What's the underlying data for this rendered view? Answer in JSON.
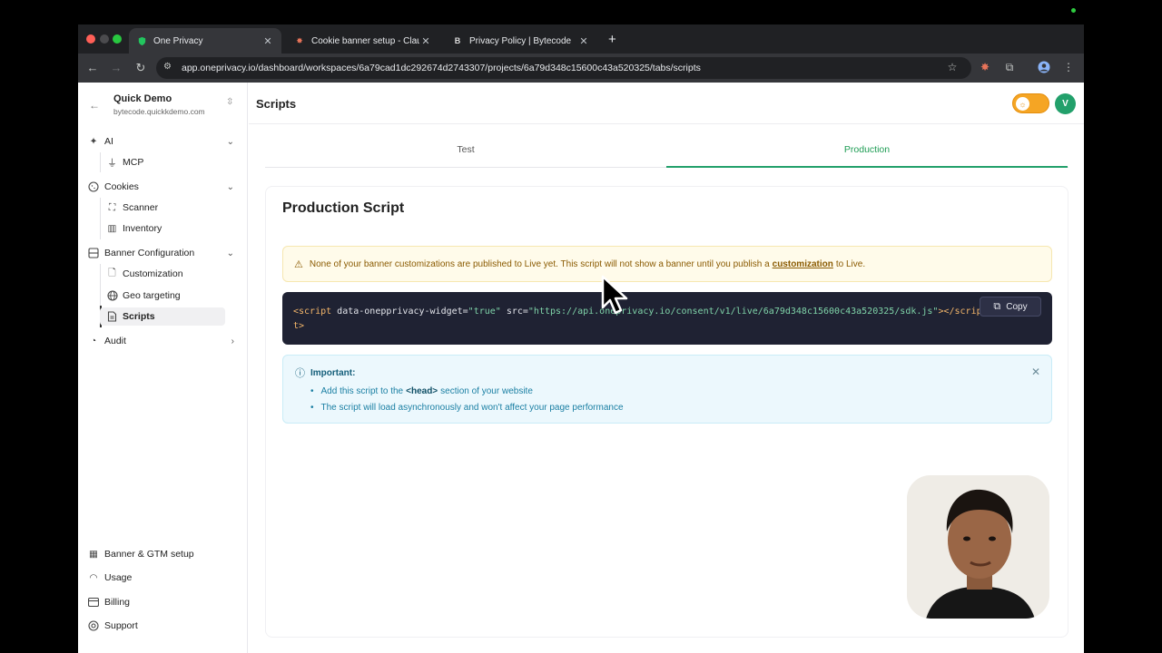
{
  "browser": {
    "tabs": [
      {
        "title": "One Privacy",
        "active": true
      },
      {
        "title": "Cookie banner setup - Claude",
        "active": false
      },
      {
        "title": "Privacy Policy | Bytecode",
        "active": false
      }
    ],
    "url": "app.oneprivacy.io/dashboard/workspaces/6a79cad1dc292674d2743307/projects/6a79d348c15600c43a520325/tabs/scripts"
  },
  "workspace": {
    "name": "Quick Demo",
    "domain": "bytecode.quickkdemo.com"
  },
  "sidebar": {
    "sections": [
      {
        "label": "AI",
        "icon": "sparkles-icon",
        "items": [
          {
            "label": "MCP",
            "icon": "plug-icon"
          }
        ]
      },
      {
        "label": "Cookies",
        "icon": "cookie-icon",
        "items": [
          {
            "label": "Scanner",
            "icon": "scan-icon"
          },
          {
            "label": "Inventory",
            "icon": "library-icon"
          }
        ]
      },
      {
        "label": "Banner Configuration",
        "icon": "layout-icon",
        "items": [
          {
            "label": "Customization",
            "icon": "file-icon"
          },
          {
            "label": "Geo targeting",
            "icon": "globe-icon"
          },
          {
            "label": "Scripts",
            "icon": "file-code-icon",
            "active": true
          }
        ]
      },
      {
        "label": "Audit",
        "icon": "audit-icon",
        "items": []
      }
    ],
    "bottom": [
      {
        "label": "Banner & GTM setup",
        "icon": "calendar-gear-icon"
      },
      {
        "label": "Usage",
        "icon": "gauge-icon"
      },
      {
        "label": "Billing",
        "icon": "credit-card-icon"
      },
      {
        "label": "Support",
        "icon": "lifebuoy-icon"
      }
    ]
  },
  "header": {
    "title": "Scripts",
    "avatar_initial": "V"
  },
  "tabs": [
    {
      "label": "Test",
      "active": false
    },
    {
      "label": "Production",
      "active": true
    }
  ],
  "card": {
    "title": "Production Script",
    "warning": {
      "text_before": "None of your banner customizations are published to Live yet. This script will not show a banner until you publish a",
      "link": "customization",
      "text_after": "to Live."
    },
    "code": {
      "tag_open": "<script",
      "attr1": " data-onepprivacy-widget=",
      "val1": "\"true\"",
      "attr2": " src=",
      "val2": "\"https://api.oneprivacy.io/consent/v1/live/6a79d348c15600c43a520325/sdk.js\"",
      "tag_close": "></scrip",
      "wrap": "t>"
    },
    "copy_label": "Copy",
    "info": {
      "title": "Important:",
      "items": [
        {
          "before": "Add this script to the ",
          "bold": "<head>",
          "after": " section of your website"
        },
        {
          "before": "The script will load asynchronously and won't affect your page performance",
          "bold": "",
          "after": ""
        }
      ]
    }
  },
  "colors": {
    "accent": "#22a06b",
    "warning_bg": "#fffbea",
    "code_bg": "#1f2233",
    "info_bg": "#ecf8fd",
    "toggle": "#f5a524"
  }
}
